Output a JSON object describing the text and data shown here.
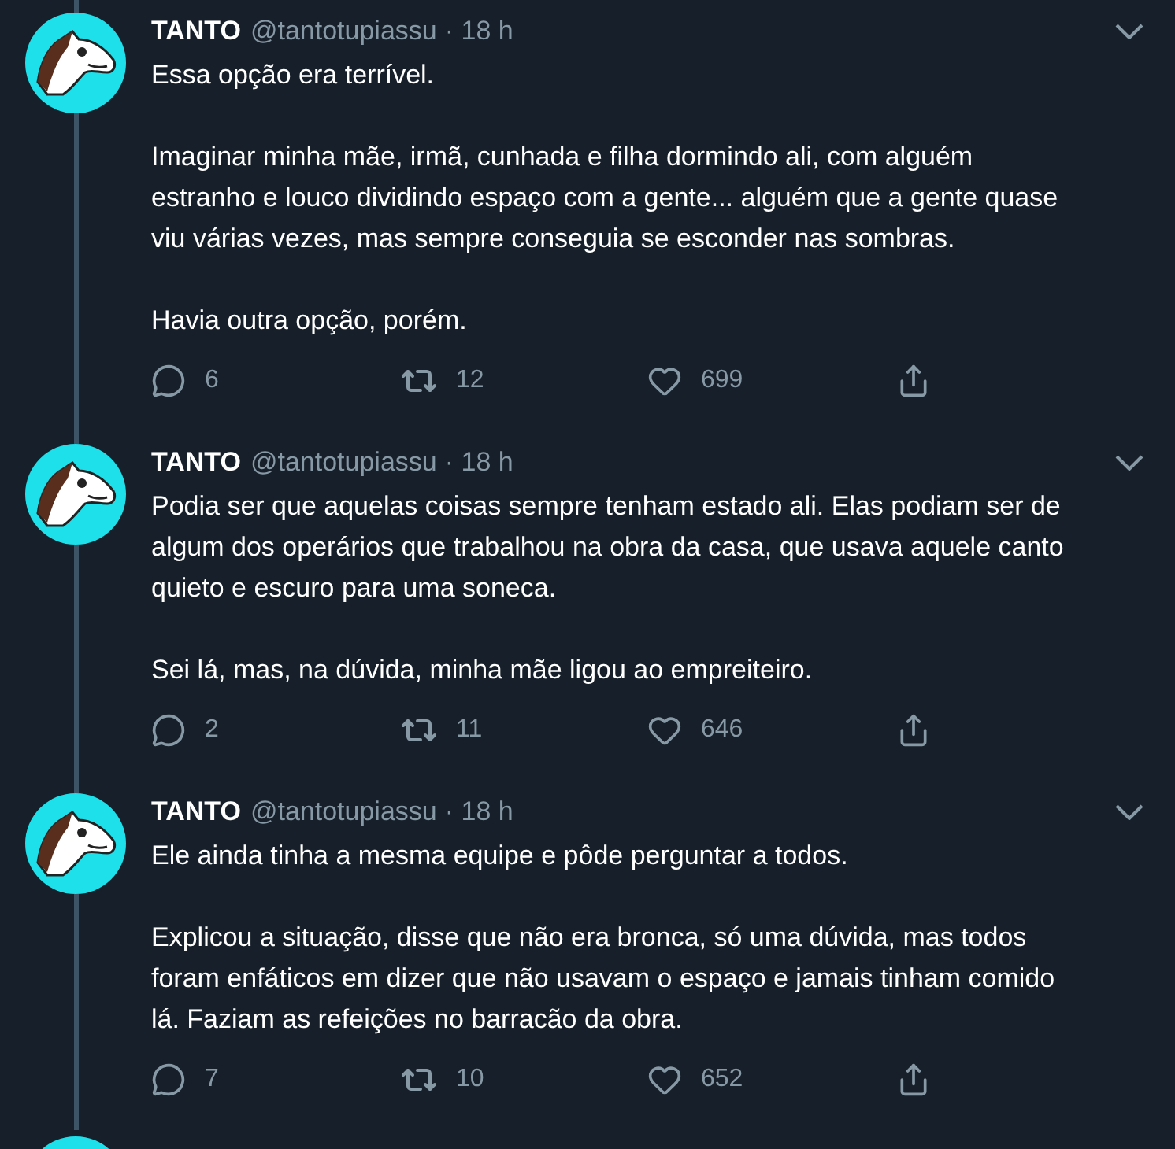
{
  "tweets": [
    {
      "name": "TANTO",
      "handle": "@tantotupiassu",
      "time": "· 18 h",
      "paragraphs": [
        "Essa opção era terrível.",
        "Imaginar minha mãe, irmã, cunhada e filha dormindo ali, com alguém\nestranho e louco dividindo espaço com a gente... alguém que a gente quase\nviu várias vezes, mas sempre conseguia se esconder nas sombras.",
        "Havia outra opção, porém."
      ],
      "replies": "6",
      "retweets": "12",
      "likes": "699"
    },
    {
      "name": "TANTO",
      "handle": "@tantotupiassu",
      "time": "· 18 h",
      "paragraphs": [
        "Podia ser que aquelas coisas sempre tenham estado ali. Elas podiam ser de\nalgum dos operários que trabalhou na obra da casa, que usava aquele canto\nquieto e escuro para uma soneca.",
        "Sei lá, mas, na dúvida, minha mãe ligou ao empreiteiro."
      ],
      "replies": "2",
      "retweets": "11",
      "likes": "646"
    },
    {
      "name": "TANTO",
      "handle": "@tantotupiassu",
      "time": "· 18 h",
      "paragraphs": [
        "Ele ainda tinha a mesma equipe e pôde perguntar a todos.",
        "Explicou a situação, disse que não era bronca, só uma dúvida, mas todos\nforam enfáticos em dizer que não usavam o espaço e jamais tinham comido\nlá. Faziam as refeições no barracão da obra."
      ],
      "replies": "7",
      "retweets": "10",
      "likes": "652"
    }
  ]
}
